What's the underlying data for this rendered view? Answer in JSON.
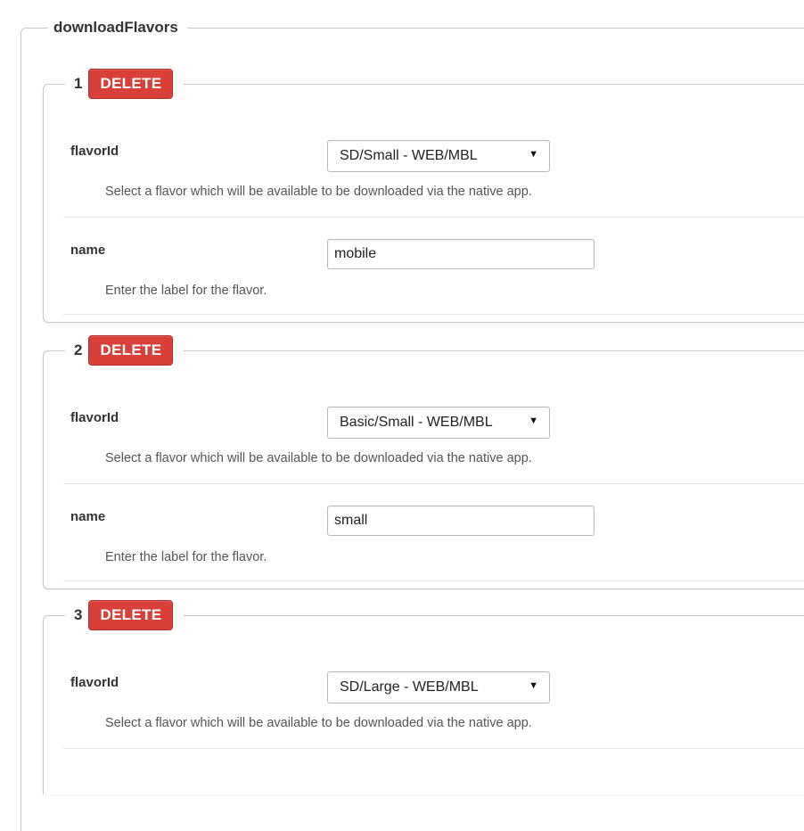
{
  "section": {
    "legend": "downloadFlavors"
  },
  "items": [
    {
      "number": "1",
      "delete_label": "DELETE",
      "flavor": {
        "label": "flavorId",
        "value": "SD/Small - WEB/MBL",
        "help": "Select a flavor which will be available to be downloaded via the native app."
      },
      "name": {
        "label": "name",
        "value": "mobile",
        "help": "Enter the label for the flavor."
      }
    },
    {
      "number": "2",
      "delete_label": "DELETE",
      "flavor": {
        "label": "flavorId",
        "value": "Basic/Small - WEB/MBL",
        "help": "Select a flavor which will be available to be downloaded via the native app."
      },
      "name": {
        "label": "name",
        "value": "small",
        "help": "Enter the label for the flavor."
      }
    },
    {
      "number": "3",
      "delete_label": "DELETE",
      "flavor": {
        "label": "flavorId",
        "value": "SD/Large - WEB/MBL",
        "help": "Select a flavor which will be available to be downloaded via the native app."
      }
    }
  ],
  "colors": {
    "delete_button": "#d9403a",
    "border": "#c8c8c8"
  },
  "icons": {
    "select_arrow": "caret-down-icon"
  }
}
